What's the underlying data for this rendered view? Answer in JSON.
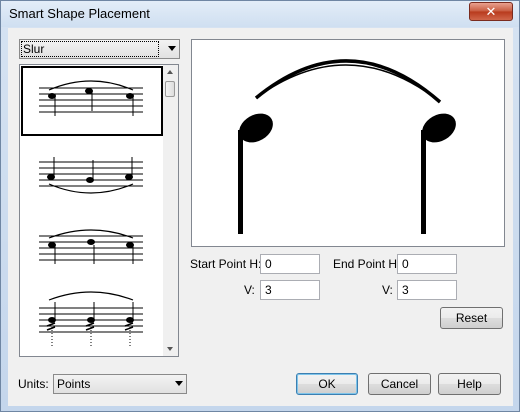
{
  "window": {
    "title": "Smart Shape Placement",
    "close_label": "✕"
  },
  "shape_type": {
    "selected": "Slur"
  },
  "start_point": {
    "h_label": "Start Point H:",
    "h_value": "0",
    "v_label": "V:",
    "v_value": "3"
  },
  "end_point": {
    "h_label": "End Point H:",
    "h_value": "0",
    "v_label": "V:",
    "v_value": "3"
  },
  "buttons": {
    "reset": "Reset",
    "ok": "OK",
    "cancel": "Cancel",
    "help": "Help"
  },
  "units": {
    "label": "Units:",
    "selected": "Points"
  },
  "icons": {
    "dropdown": "chevron-down-icon",
    "close": "close-icon",
    "scroll_up": "arrow-up-icon",
    "scroll_down": "arrow-down-icon"
  },
  "colors": {
    "default_button_border": "#3c7fb1",
    "close_button": "#c75a3e",
    "list_selection_outline": "#000000"
  }
}
